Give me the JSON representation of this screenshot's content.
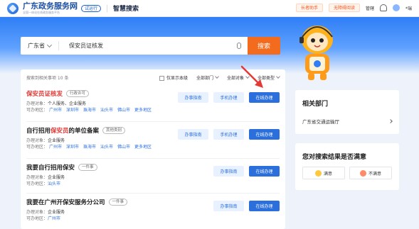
{
  "header": {
    "site_title": "广东政务服务网",
    "site_subtitle": "全国一体化在线政务服务平台",
    "beta_label": "试运行",
    "page_name": "智慧搜索",
    "elder_helper": "长者助手",
    "barrier_free": "无障碍阅读",
    "admin_label": "管辖",
    "user_label": "*瑞"
  },
  "search": {
    "region": "广东省",
    "query": "保安员证核发",
    "button": "搜索"
  },
  "results": {
    "count_text": "搜索到相关事项 10 条",
    "only_province_label": "仅显示本级",
    "dept_filter": "全部部门",
    "object_filter": "全部对象",
    "type_filter": "全部类型",
    "items": [
      {
        "title_hl": "保安员证核发",
        "title_rest": "",
        "tag": "行政许可",
        "obj_label": "办理对象：",
        "obj_value": "个人服务、企业服务",
        "area_label": "可办地区：",
        "cities": [
          "广州市",
          "深圳市",
          "珠海市",
          "汕头市",
          "佛山市",
          "更多地区"
        ],
        "btns": [
          "办事指南",
          "手机办理",
          "在线办理"
        ]
      },
      {
        "title_pre": "自行招用",
        "title_hl": "保安员",
        "title_rest": "的单位备案",
        "tag": "其他类别",
        "obj_label": "办理对象：",
        "obj_value": "企业服务",
        "area_label": "可办地区：",
        "cities": [
          "广州市",
          "深圳市",
          "珠海市",
          "汕头市",
          "佛山市",
          "更多地区"
        ],
        "btns": [
          "办事指南",
          "手机办理",
          "在线办理"
        ]
      },
      {
        "title": "我要自行招用保安",
        "tag": "一件事",
        "obj_label": "办理对象：",
        "obj_value": "企业服务",
        "area_label": "可办地区：",
        "cities": [
          "汕头市"
        ],
        "btns": [
          "办事指南",
          "在线办理"
        ]
      },
      {
        "title": "我要在广州开保安服务分公司",
        "tag": "一件事",
        "obj_label": "办理对象：",
        "obj_value": "企业服务",
        "area_label": "可办地区：",
        "cities": [
          "广州市"
        ],
        "btns": [
          "办事指南",
          "在线办理"
        ]
      }
    ]
  },
  "related": {
    "title": "相关部门",
    "dept": "广东省交通运输厅"
  },
  "feedback": {
    "title": "您对搜索结果是否满意",
    "yes": "满意",
    "no": "不满意"
  }
}
